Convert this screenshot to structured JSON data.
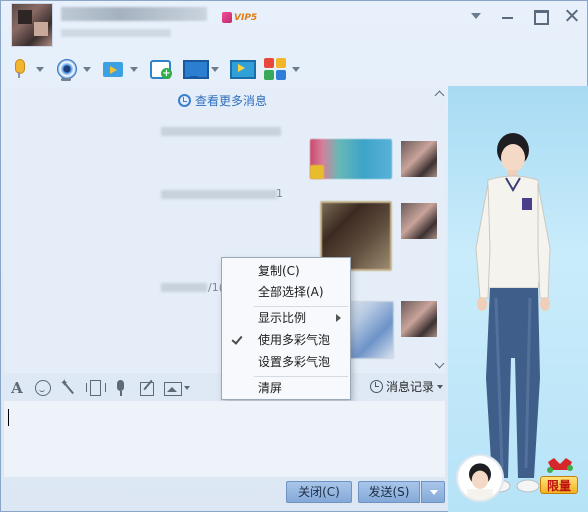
{
  "window": {
    "vip_label": "VIP5"
  },
  "toolbar": {
    "items": [
      {
        "name": "voice",
        "icon": "microphone-icon"
      },
      {
        "name": "video",
        "icon": "webcam-icon"
      },
      {
        "name": "file",
        "icon": "folder-transfer-icon"
      },
      {
        "name": "create-discussion",
        "icon": "note-add-icon"
      },
      {
        "name": "remote",
        "icon": "remote-screen-icon"
      },
      {
        "name": "share-screen",
        "icon": "screen-share-icon"
      },
      {
        "name": "apps",
        "icon": "app-grid-icon"
      }
    ]
  },
  "chat": {
    "more_messages": "查看更多消息",
    "fragments": [
      "1",
      "/1("
    ]
  },
  "context_menu": {
    "items": [
      {
        "label": "复制(C)",
        "checked": false,
        "submenu": false
      },
      {
        "label": "全部选择(A)",
        "checked": false,
        "submenu": false
      },
      {
        "label": "显示比例",
        "checked": false,
        "submenu": true
      },
      {
        "label": "使用多彩气泡",
        "checked": true,
        "submenu": false
      },
      {
        "label": "设置多彩气泡",
        "checked": false,
        "submenu": false
      },
      {
        "label": "清屏",
        "checked": false,
        "submenu": false
      }
    ]
  },
  "format_bar": {
    "font_label": "A",
    "history_label": "消息记录"
  },
  "buttons": {
    "close": "关闭(C)",
    "send": "发送(S)"
  },
  "show": {
    "gift_label": "限量"
  },
  "colors": {
    "accent": "#2f6fbf",
    "button_bg": "#9bbbe3",
    "panel_bg": "#b7e3f7"
  }
}
